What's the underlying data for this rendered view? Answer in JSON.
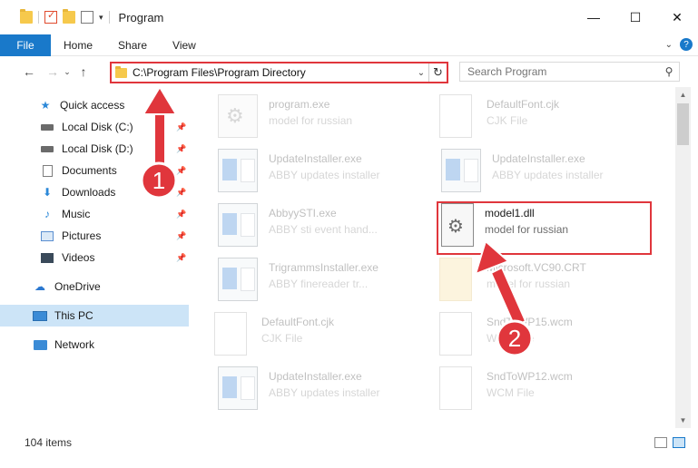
{
  "window": {
    "title": "Program",
    "minimize_glyph": "—",
    "maximize_glyph": "☐",
    "close_glyph": "✕"
  },
  "ribbon": {
    "file": "File",
    "tabs": [
      "Home",
      "Share",
      "View"
    ]
  },
  "address": {
    "path": "C:\\Program Files\\Program Directory"
  },
  "search": {
    "placeholder": "Search Program"
  },
  "sidebar": {
    "items": [
      {
        "label": "Quick access",
        "icon": "star-icon"
      },
      {
        "label": "Local Disk (C:)",
        "icon": "disk-icon"
      },
      {
        "label": "Local Disk (D:)",
        "icon": "disk-icon"
      },
      {
        "label": "Documents",
        "icon": "documents-icon"
      },
      {
        "label": "Downloads",
        "icon": "download-icon"
      },
      {
        "label": "Music",
        "icon": "music-icon"
      },
      {
        "label": "Pictures",
        "icon": "pictures-icon"
      },
      {
        "label": "Videos",
        "icon": "videos-icon"
      },
      {
        "label": "OneDrive",
        "icon": "cloud-icon"
      },
      {
        "label": "This PC",
        "icon": "computer-icon"
      },
      {
        "label": "Network",
        "icon": "network-icon"
      }
    ]
  },
  "files": [
    {
      "name": "program.exe",
      "type": "model for russian",
      "icon": "setup-icon"
    },
    {
      "name": "DefaultFont.cjk",
      "type": "CJK File",
      "icon": "document-icon"
    },
    {
      "name": "UpdateInstaller.exe",
      "type": "ABBY updates installer",
      "icon": "application-icon"
    },
    {
      "name": "UpdateInstaller.exe",
      "type": "ABBY updates installer",
      "icon": "application-icon"
    },
    {
      "name": "AbbyySTI.exe",
      "type": "ABBY sti event hand...",
      "icon": "application-icon"
    },
    {
      "name": "model1.dll",
      "type": "model for russian",
      "icon": "dll-gear-icon"
    },
    {
      "name": "TrigrammsInstaller.exe",
      "type": "ABBY finereader tr...",
      "icon": "application-icon"
    },
    {
      "name": "Microsoft.VC90.CRT",
      "type": "model for russian",
      "icon": "folder-icon"
    },
    {
      "name": "DefaultFont.cjk",
      "type": "CJK File",
      "icon": "document-icon"
    },
    {
      "name": "SndToWP15.wcm",
      "type": "WCM File",
      "icon": "document-icon"
    },
    {
      "name": "UpdateInstaller.exe",
      "type": "ABBY updates installer",
      "icon": "application-icon"
    },
    {
      "name": "SndToWP12.wcm",
      "type": "WCM File",
      "icon": "document-icon"
    }
  ],
  "status": {
    "items": "104 items"
  },
  "annotations": {
    "badge1": "1",
    "badge2": "2",
    "badge_color": "#e0363c",
    "arrow_color": "#e0363c"
  }
}
